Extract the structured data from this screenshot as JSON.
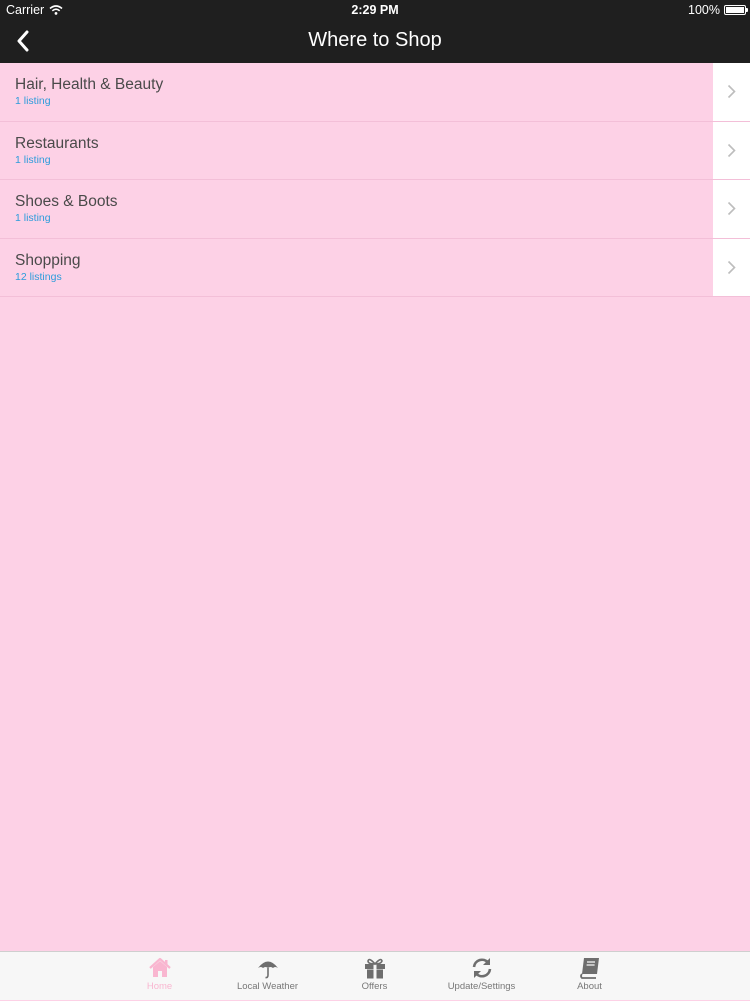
{
  "status_bar": {
    "carrier": "Carrier",
    "time": "2:29 PM",
    "battery": "100%"
  },
  "nav": {
    "title": "Where to Shop"
  },
  "listings": [
    {
      "label": "Hair, Health & Beauty",
      "count": "1 listing"
    },
    {
      "label": "Restaurants",
      "count": "1 listing"
    },
    {
      "label": "Shoes & Boots",
      "count": "1 listing"
    },
    {
      "label": "Shopping",
      "count": "12 listings"
    }
  ],
  "tabs": [
    {
      "label": "Home",
      "icon": "home-icon",
      "active": true
    },
    {
      "label": "Local Weather",
      "icon": "umbrella-icon",
      "active": false
    },
    {
      "label": "Offers",
      "icon": "gift-icon",
      "active": false
    },
    {
      "label": "Update/Settings",
      "icon": "refresh-icon",
      "active": false
    },
    {
      "label": "About",
      "icon": "book-icon",
      "active": false
    }
  ],
  "colors": {
    "nav_background": "#1f1f1f",
    "page_background": "#FDD1E6",
    "listing_count": "#2d9cdb",
    "active_tab": "#f9b6d0",
    "inactive_tab": "#777777"
  }
}
